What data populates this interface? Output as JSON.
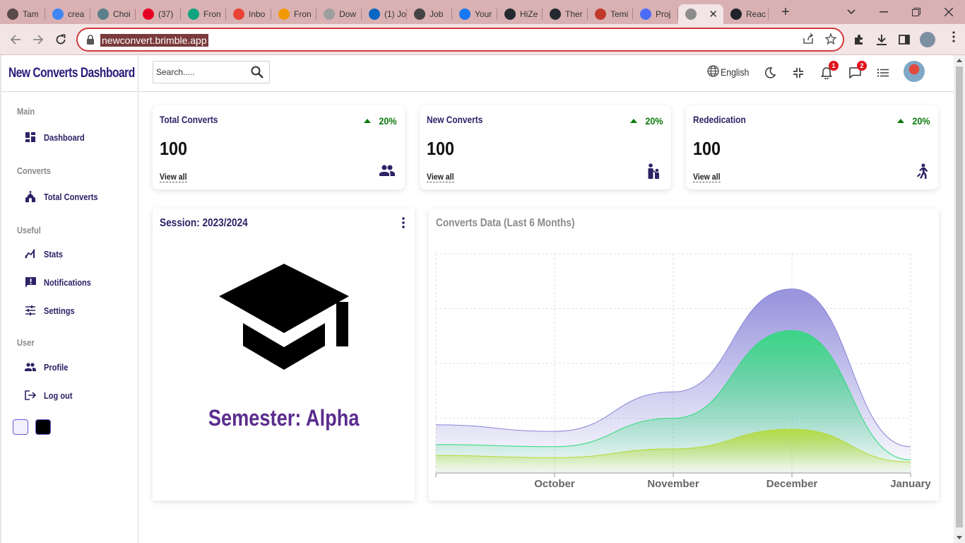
{
  "browser": {
    "tabs": [
      {
        "label": "Tam",
        "fav_color": "#5a4a4a"
      },
      {
        "label": "crea",
        "fav_color": "#4285f4"
      },
      {
        "label": "Choi",
        "fav_color": "#5a7f8a"
      },
      {
        "label": "(37)",
        "fav_color": "#e60023"
      },
      {
        "label": "Fron",
        "fav_color": "#10a37f"
      },
      {
        "label": "Inbo",
        "fav_color": "#ea4335"
      },
      {
        "label": "Fron",
        "fav_color": "#f29900"
      },
      {
        "label": "Dow",
        "fav_color": "#9e9e9e"
      },
      {
        "label": "(1) Jo",
        "fav_color": "#0a66c2"
      },
      {
        "label": "Job",
        "fav_color": "#444444"
      },
      {
        "label": "Your",
        "fav_color": "#1877f2"
      },
      {
        "label": "HiZe",
        "fav_color": "#24292f"
      },
      {
        "label": "Ther",
        "fav_color": "#24292f"
      },
      {
        "label": "Temi",
        "fav_color": "#c0392b"
      },
      {
        "label": "Proj",
        "fav_color": "#4a6cf7"
      },
      {
        "label": "",
        "fav_color": "#8c8c8c"
      },
      {
        "label": "Reac",
        "fav_color": "#20232a"
      }
    ],
    "url": "newconvert.brimble.app"
  },
  "sidebar": {
    "brand": "New Converts Dashboard",
    "sections": [
      {
        "title": "Main",
        "items": [
          {
            "label": "Dashboard",
            "icon": "dashboard-icon"
          }
        ]
      },
      {
        "title": "Converts",
        "items": [
          {
            "label": "Total Converts",
            "icon": "church-icon"
          }
        ]
      },
      {
        "title": "Useful",
        "items": [
          {
            "label": "Stats",
            "icon": "stats-icon"
          },
          {
            "label": "Notifications",
            "icon": "notification-icon"
          },
          {
            "label": "Settings",
            "icon": "tune-icon"
          }
        ]
      },
      {
        "title": "User",
        "items": [
          {
            "label": "Profile",
            "icon": "people-icon"
          },
          {
            "label": "Log out",
            "icon": "logout-icon"
          }
        ]
      }
    ],
    "theme_colors": [
      "#f3f0ff",
      "#000000"
    ]
  },
  "topbar": {
    "search_placeholder": "Search.....",
    "language": "English",
    "notifications_count": "1",
    "messages_count": "2"
  },
  "stats": [
    {
      "title": "Total Converts",
      "change": "20%",
      "value": "100",
      "link": "View all",
      "icon": "group-icon"
    },
    {
      "title": "New Converts",
      "change": "20%",
      "value": "100",
      "link": "View all",
      "icon": "family-icon"
    },
    {
      "title": "Rededication",
      "change": "20%",
      "value": "100",
      "link": "View all",
      "icon": "running-icon"
    }
  ],
  "session": {
    "title": "Session: 2023/2024",
    "semester": "Semester: Alpha"
  },
  "chart": {
    "title": "Converts Data (Last 6 Months)"
  },
  "chart_data": {
    "type": "area",
    "x": [
      "",
      "October",
      "November",
      "December",
      "January"
    ],
    "series": [
      {
        "values": [
          22,
          19,
          37,
          84,
          12
        ],
        "color": "#8884d8"
      },
      {
        "values": [
          13,
          12,
          25,
          65,
          6
        ],
        "color": "#2ddb7a"
      },
      {
        "values": [
          8,
          7,
          11,
          20,
          5
        ],
        "color": "#b5d935"
      }
    ],
    "ylim": [
      0,
      100
    ],
    "grid": true
  }
}
